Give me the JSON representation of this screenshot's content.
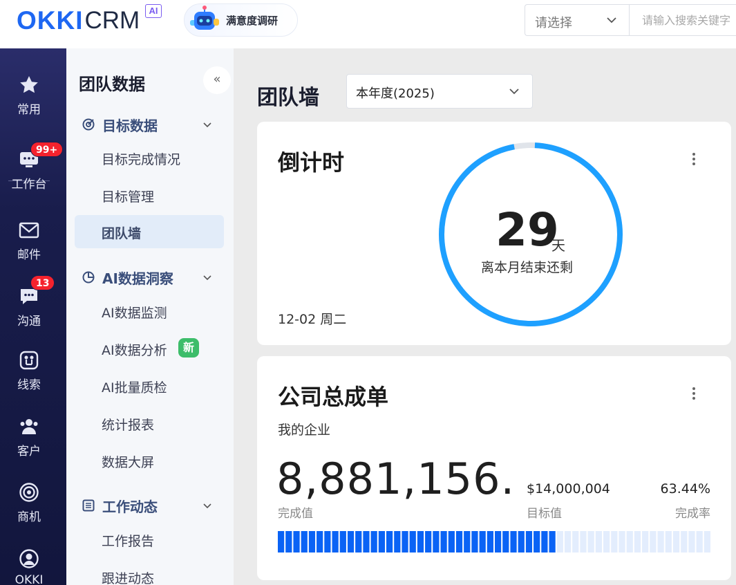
{
  "header": {
    "logo_main": "OKKI",
    "logo_sub": "CRM",
    "logo_badge": "AI",
    "survey_label": "满意度调研",
    "select_placeholder": "请选择",
    "search_placeholder": "请输入搜索关键字"
  },
  "rail": {
    "items": [
      {
        "label": "常用",
        "icon": "star-icon"
      },
      {
        "label": "工作台",
        "icon": "workbench-icon",
        "badge": "99+"
      },
      {
        "label": "邮件",
        "icon": "mail-icon"
      },
      {
        "label": "沟通",
        "icon": "chat-icon",
        "badge": "13"
      },
      {
        "label": "线索",
        "icon": "leads-icon"
      },
      {
        "label": "客户",
        "icon": "customers-icon"
      },
      {
        "label": "商机",
        "icon": "target-icon"
      },
      {
        "label": "OKKI",
        "icon": "profile-icon"
      }
    ]
  },
  "subnav": {
    "title": "团队数据",
    "collapse": "«",
    "groups": [
      {
        "label": "目标数据",
        "icon": "goal-icon",
        "items": [
          "目标完成情况",
          "目标管理",
          "团队墙"
        ]
      },
      {
        "label": "AI数据洞察",
        "icon": "pie-icon",
        "items": [
          "AI数据监测",
          "AI数据分析",
          "AI批量质检",
          "统计报表",
          "数据大屏"
        ]
      },
      {
        "label": "工作动态",
        "icon": "list-icon",
        "items": [
          "工作报告",
          "跟进动态"
        ]
      }
    ],
    "new_tag": "新",
    "active_item": "团队墙"
  },
  "main": {
    "page_title": "团队墙",
    "year_select": "本年度(2025)",
    "countdown": {
      "title": "倒计时",
      "date": "12-02 周二",
      "days": "29",
      "unit": "天",
      "caption": "离本月结束还剩",
      "progress": 0.97,
      "ring_color": "#1ea0ff",
      "track_color": "#e0e4ea"
    },
    "company_total": {
      "title": "公司总成单",
      "subtitle": "我的企业",
      "completed_value": "8,881,156....",
      "completed_caption": "完成值",
      "target_value": "$14,000,004",
      "target_caption": "目标值",
      "rate_value": "63.44%",
      "rate_caption": "完成率",
      "rate": 0.6344,
      "fill_color": "#0a63f5",
      "empty_color": "#e3edfd"
    }
  }
}
